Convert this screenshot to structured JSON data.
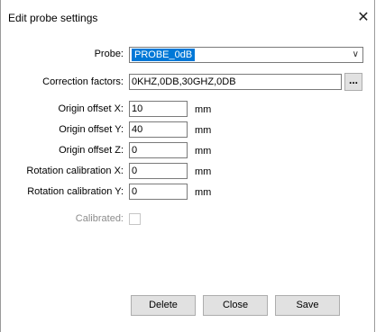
{
  "window": {
    "title": "Edit probe settings"
  },
  "form": {
    "probe_label": "Probe:",
    "probe_value": "PROBE_0dB",
    "correction_label": "Correction factors:",
    "correction_value": "0KHZ,0DB,30GHZ,0DB",
    "browse_label": "...",
    "origin_x_label": "Origin offset X:",
    "origin_x_value": "10",
    "origin_y_label": "Origin offset Y:",
    "origin_y_value": "40",
    "origin_z_label": "Origin offset Z:",
    "origin_z_value": "0",
    "rot_x_label": "Rotation calibration X:",
    "rot_x_value": "0",
    "rot_y_label": "Rotation calibration Y:",
    "rot_y_value": "0",
    "unit": "mm",
    "calibrated_label": "Calibrated:",
    "calibrated_checked": false
  },
  "buttons": {
    "delete": "Delete",
    "close": "Close",
    "save": "Save"
  },
  "colors": {
    "selection": "#0078d7",
    "button_face": "#e1e1e1",
    "disabled_text": "#8c8c8c"
  }
}
